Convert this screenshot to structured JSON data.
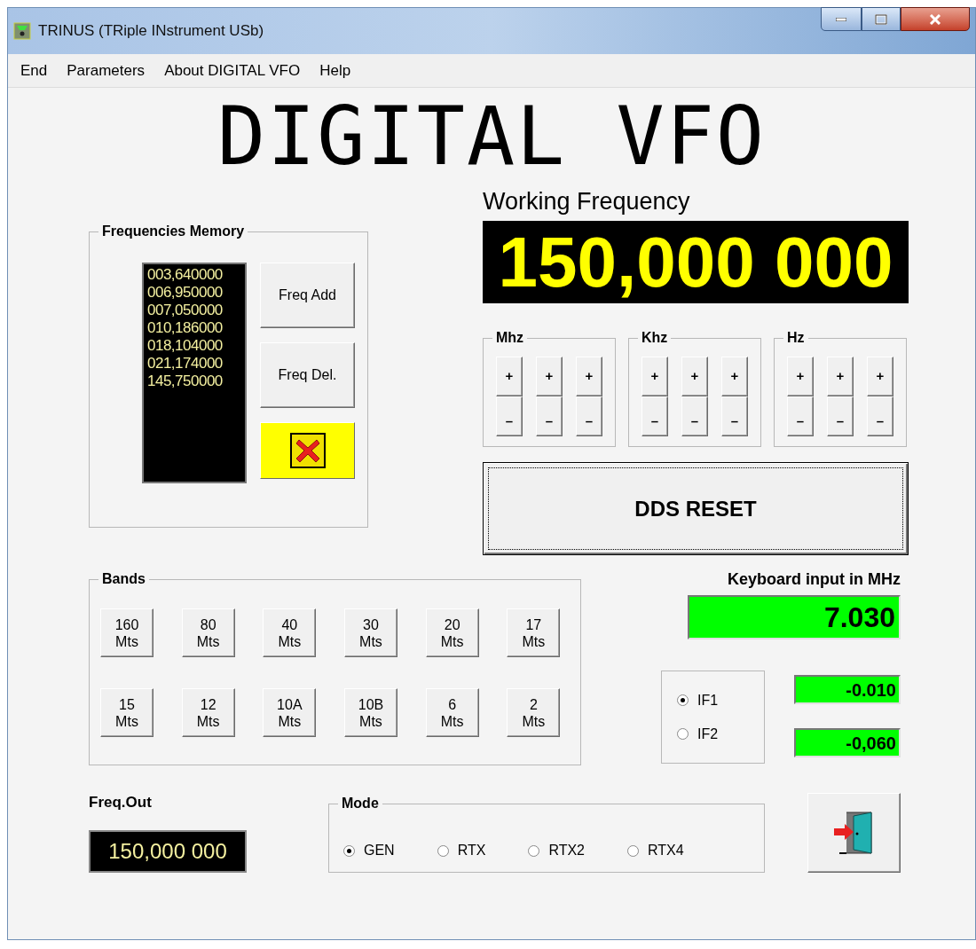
{
  "window": {
    "title": "TRINUS (TRiple INstrument USb)"
  },
  "menu": [
    "End",
    "Parameters",
    "About DIGITAL VFO",
    "Help"
  ],
  "heading": "DIGITAL VFO",
  "memory": {
    "title": "Frequencies Memory",
    "entries": [
      "003,640000",
      "006,950000",
      "007,050000",
      "010,186000",
      "018,104000",
      "021,174000",
      "145,750000"
    ],
    "buttons": [
      "Freq Add",
      "Freq Del."
    ]
  },
  "working": {
    "label": "Working Frequency",
    "value": "150,000 000"
  },
  "steppers": [
    {
      "title": "Mhz",
      "columns": [
        {
          "up": "+",
          "down": "–"
        },
        {
          "up": "+",
          "down": "–"
        },
        {
          "up": "+",
          "down": "–"
        }
      ]
    },
    {
      "title": "Khz",
      "columns": [
        {
          "up": "+",
          "down": "–"
        },
        {
          "up": "+",
          "down": "–"
        },
        {
          "up": "+",
          "down": "–"
        }
      ]
    },
    {
      "title": "Hz",
      "columns": [
        {
          "up": "+",
          "down": "–"
        },
        {
          "up": "+",
          "down": "–"
        },
        {
          "up": "+",
          "down": "–"
        }
      ]
    }
  ],
  "dds_reset": "DDS RESET",
  "bands": {
    "title": "Bands",
    "buttons": [
      {
        "number": "160",
        "unit": "Mts"
      },
      {
        "number": "80",
        "unit": "Mts"
      },
      {
        "number": "40",
        "unit": "Mts"
      },
      {
        "number": "30",
        "unit": "Mts"
      },
      {
        "number": "20",
        "unit": "Mts"
      },
      {
        "number": "17",
        "unit": "Mts"
      },
      {
        "number": "15",
        "unit": "Mts"
      },
      {
        "number": "12",
        "unit": "Mts"
      },
      {
        "number": "10A",
        "unit": "Mts"
      },
      {
        "number": "10B",
        "unit": "Mts"
      },
      {
        "number": "6",
        "unit": "Mts"
      },
      {
        "number": "2",
        "unit": "Mts"
      }
    ]
  },
  "keyboard": {
    "label": "Keyboard input in MHz",
    "value": "7.030"
  },
  "if": {
    "options": [
      {
        "label": "IF1",
        "selected": true
      },
      {
        "label": "IF2",
        "selected": false
      }
    ],
    "offsets": [
      "-0.010",
      "-0,060"
    ]
  },
  "freq_out": {
    "label": "Freq.Out",
    "value": "150,000 000"
  },
  "mode": {
    "title": "Mode",
    "options": [
      {
        "label": "GEN",
        "selected": true
      },
      {
        "label": "RTX",
        "selected": false
      },
      {
        "label": "RTX2",
        "selected": false
      },
      {
        "label": "RTX4",
        "selected": false
      }
    ]
  }
}
